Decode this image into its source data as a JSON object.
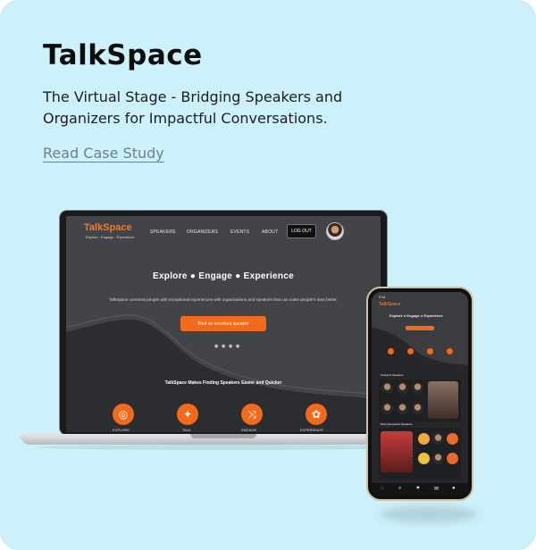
{
  "title": "TalkSpace",
  "subtitle": "The Virtual Stage - Bridging Speakers and Organizers for Impactful Conversations.",
  "cta": "Read Case Study",
  "laptop": {
    "logo": "TalkSpace",
    "logo_tagline": "Explore · Engage · Experience",
    "nav": [
      "SPEAKERS",
      "ORGANIZERS",
      "EVENTS",
      "ABOUT"
    ],
    "logout_label": "LOG OUT",
    "hero_title": "Explore  ●  Engage  ●  Experience",
    "hero_text": "TalkSpace connects people with exceptional experiences with organizations and speakers that can make people's lives better.",
    "hero_button": "Find an excellent speaker",
    "section_title": "TalkSpace Makes Finding Speakers Easier and Quicker",
    "features": [
      "EXPLORE",
      "TALK",
      "ENGAGE",
      "EXPERIENCE"
    ]
  },
  "phone": {
    "time": "9:41",
    "hero_title": "Explore ● Engage ● Experience",
    "sections": [
      "Featured Speakers",
      "Most Requested Speakers"
    ]
  },
  "colors": {
    "background": "#cdf1fb",
    "accent": "#f26a1b",
    "screen": "#3a3b3f"
  }
}
